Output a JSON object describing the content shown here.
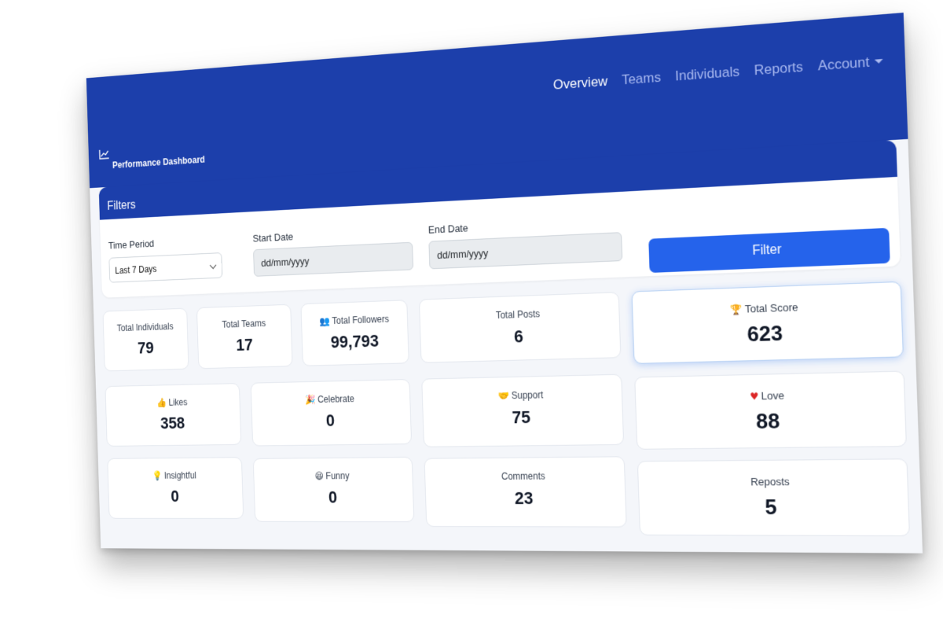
{
  "app": {
    "title": "Performance Dashboard"
  },
  "nav": {
    "items": [
      {
        "label": "Overview"
      },
      {
        "label": "Teams"
      },
      {
        "label": "Individuals"
      },
      {
        "label": "Reports"
      },
      {
        "label": "Account"
      }
    ]
  },
  "filters": {
    "title": "Filters",
    "time_period": {
      "label": "Time Period",
      "value": "Last 7 Days"
    },
    "start_date": {
      "label": "Start Date",
      "placeholder": "dd/mm/yyyy"
    },
    "end_date": {
      "label": "End Date",
      "placeholder": "dd/mm/yyyy"
    },
    "filter_button": "Filter"
  },
  "stats": {
    "total_individuals": {
      "label": "Total Individuals",
      "value": "79"
    },
    "total_teams": {
      "label": "Total Teams",
      "value": "17"
    },
    "total_followers": {
      "label": "Total Followers",
      "value": "99,793",
      "icon": "people-icon"
    },
    "total_posts": {
      "label": "Total Posts",
      "value": "6"
    },
    "total_score": {
      "label": "Total Score",
      "value": "623",
      "icon": "trophy-icon"
    },
    "likes": {
      "label": "Likes",
      "value": "358",
      "icon": "thumbs-up-icon"
    },
    "celebrate": {
      "label": "Celebrate",
      "value": "0",
      "icon": "party-popper-icon"
    },
    "support": {
      "label": "Support",
      "value": "75",
      "icon": "handshake-icon"
    },
    "love": {
      "label": "Love",
      "value": "88",
      "icon": "heart-icon"
    },
    "insightful": {
      "label": "Insightful",
      "value": "0",
      "icon": "lightbulb-icon"
    },
    "funny": {
      "label": "Funny",
      "value": "0",
      "icon": "laughing-face-icon"
    },
    "comments": {
      "label": "Comments",
      "value": "23"
    },
    "reposts": {
      "label": "Reposts",
      "value": "5"
    }
  },
  "colors": {
    "header": "#1c3fab",
    "nav_active": "#ffffff",
    "nav_inactive": "#a9b9f0",
    "primary_button": "#2563eb",
    "page_background": "#f4f6fa",
    "highlight_border": "#b9d2f3"
  }
}
